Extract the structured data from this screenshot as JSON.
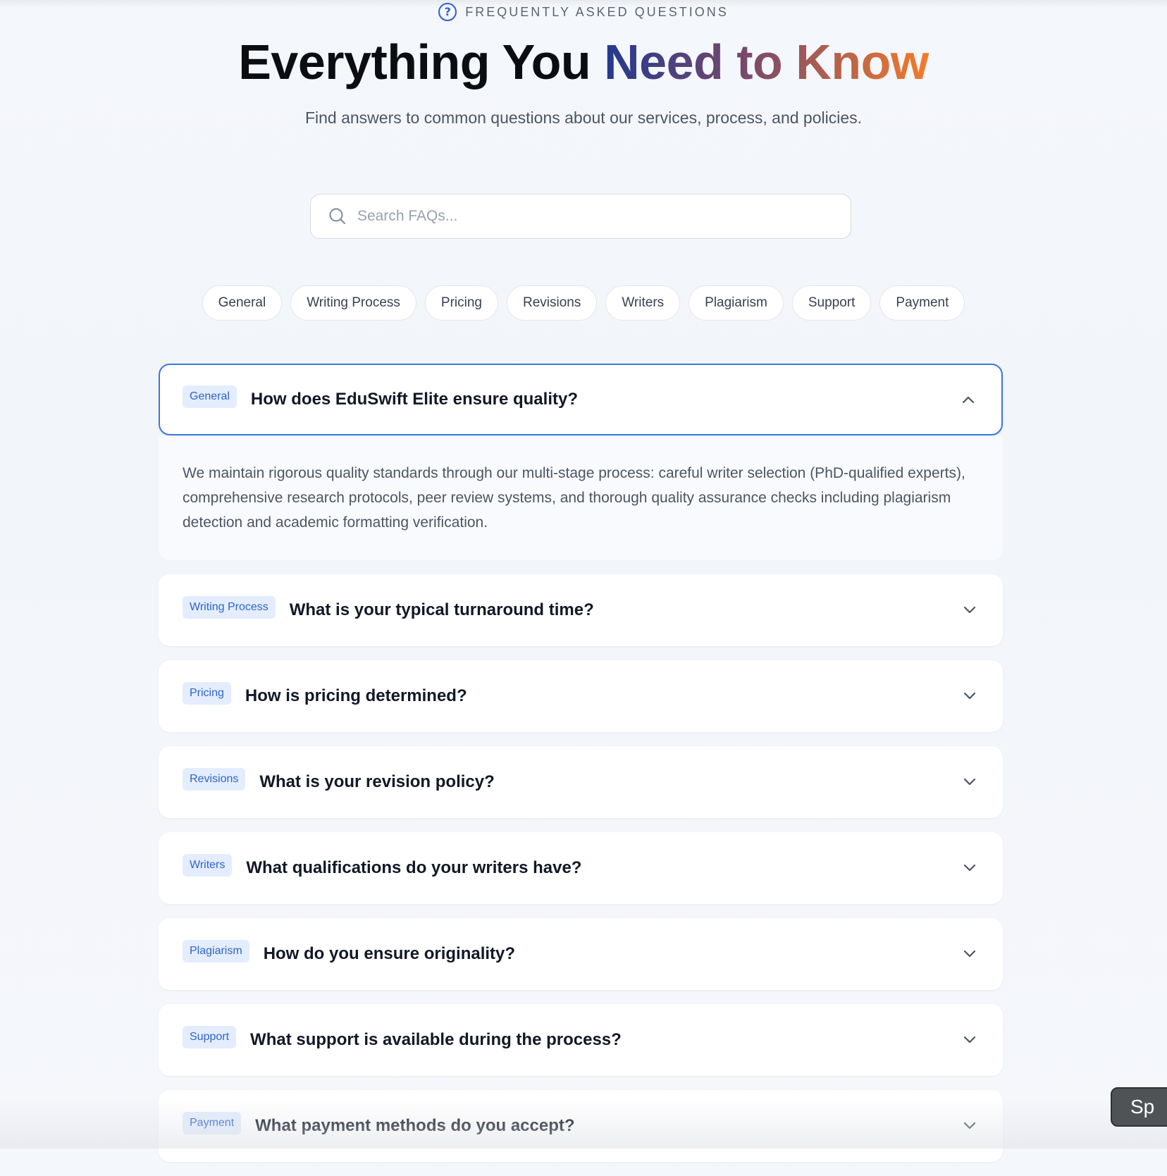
{
  "header": {
    "eyebrow": "FREQUENTLY ASKED QUESTIONS",
    "headline_plain": "Everything You ",
    "headline_gradient": "Need to Know",
    "subtitle": "Find answers to common questions about our services, process, and policies.",
    "gradient_colors": [
      "#24398f",
      "#7a4a6a",
      "#f47b2a"
    ],
    "icon": "question-circle-icon"
  },
  "search": {
    "placeholder": "Search FAQs...",
    "value": "",
    "icon": "search-icon"
  },
  "categories": [
    "General",
    "Writing Process",
    "Pricing",
    "Revisions",
    "Writers",
    "Plagiarism",
    "Support",
    "Payment"
  ],
  "faqs": [
    {
      "tag": "General",
      "question": "How does EduSwift Elite ensure quality?",
      "open": true,
      "answer": "We maintain rigorous quality standards through our multi-stage process: careful writer selection (PhD-qualified experts), comprehensive research protocols, peer review systems, and thorough quality assurance checks including plagiarism detection and academic formatting verification."
    },
    {
      "tag": "Writing Process",
      "question": "What is your typical turnaround time?",
      "open": false
    },
    {
      "tag": "Pricing",
      "question": "How is pricing determined?",
      "open": false
    },
    {
      "tag": "Revisions",
      "question": "What is your revision policy?",
      "open": false
    },
    {
      "tag": "Writers",
      "question": "What qualifications do your writers have?",
      "open": false
    },
    {
      "tag": "Plagiarism",
      "question": "How do you ensure originality?",
      "open": false
    },
    {
      "tag": "Support",
      "question": "What support is available during the process?",
      "open": false
    },
    {
      "tag": "Payment",
      "question": "What payment methods do you accept?",
      "open": false
    }
  ],
  "floating_button": {
    "label": "Sp"
  },
  "colors": {
    "accent": "#3b78db",
    "tag_bg": "#e3edfd",
    "tag_text": "#2f64c9"
  }
}
